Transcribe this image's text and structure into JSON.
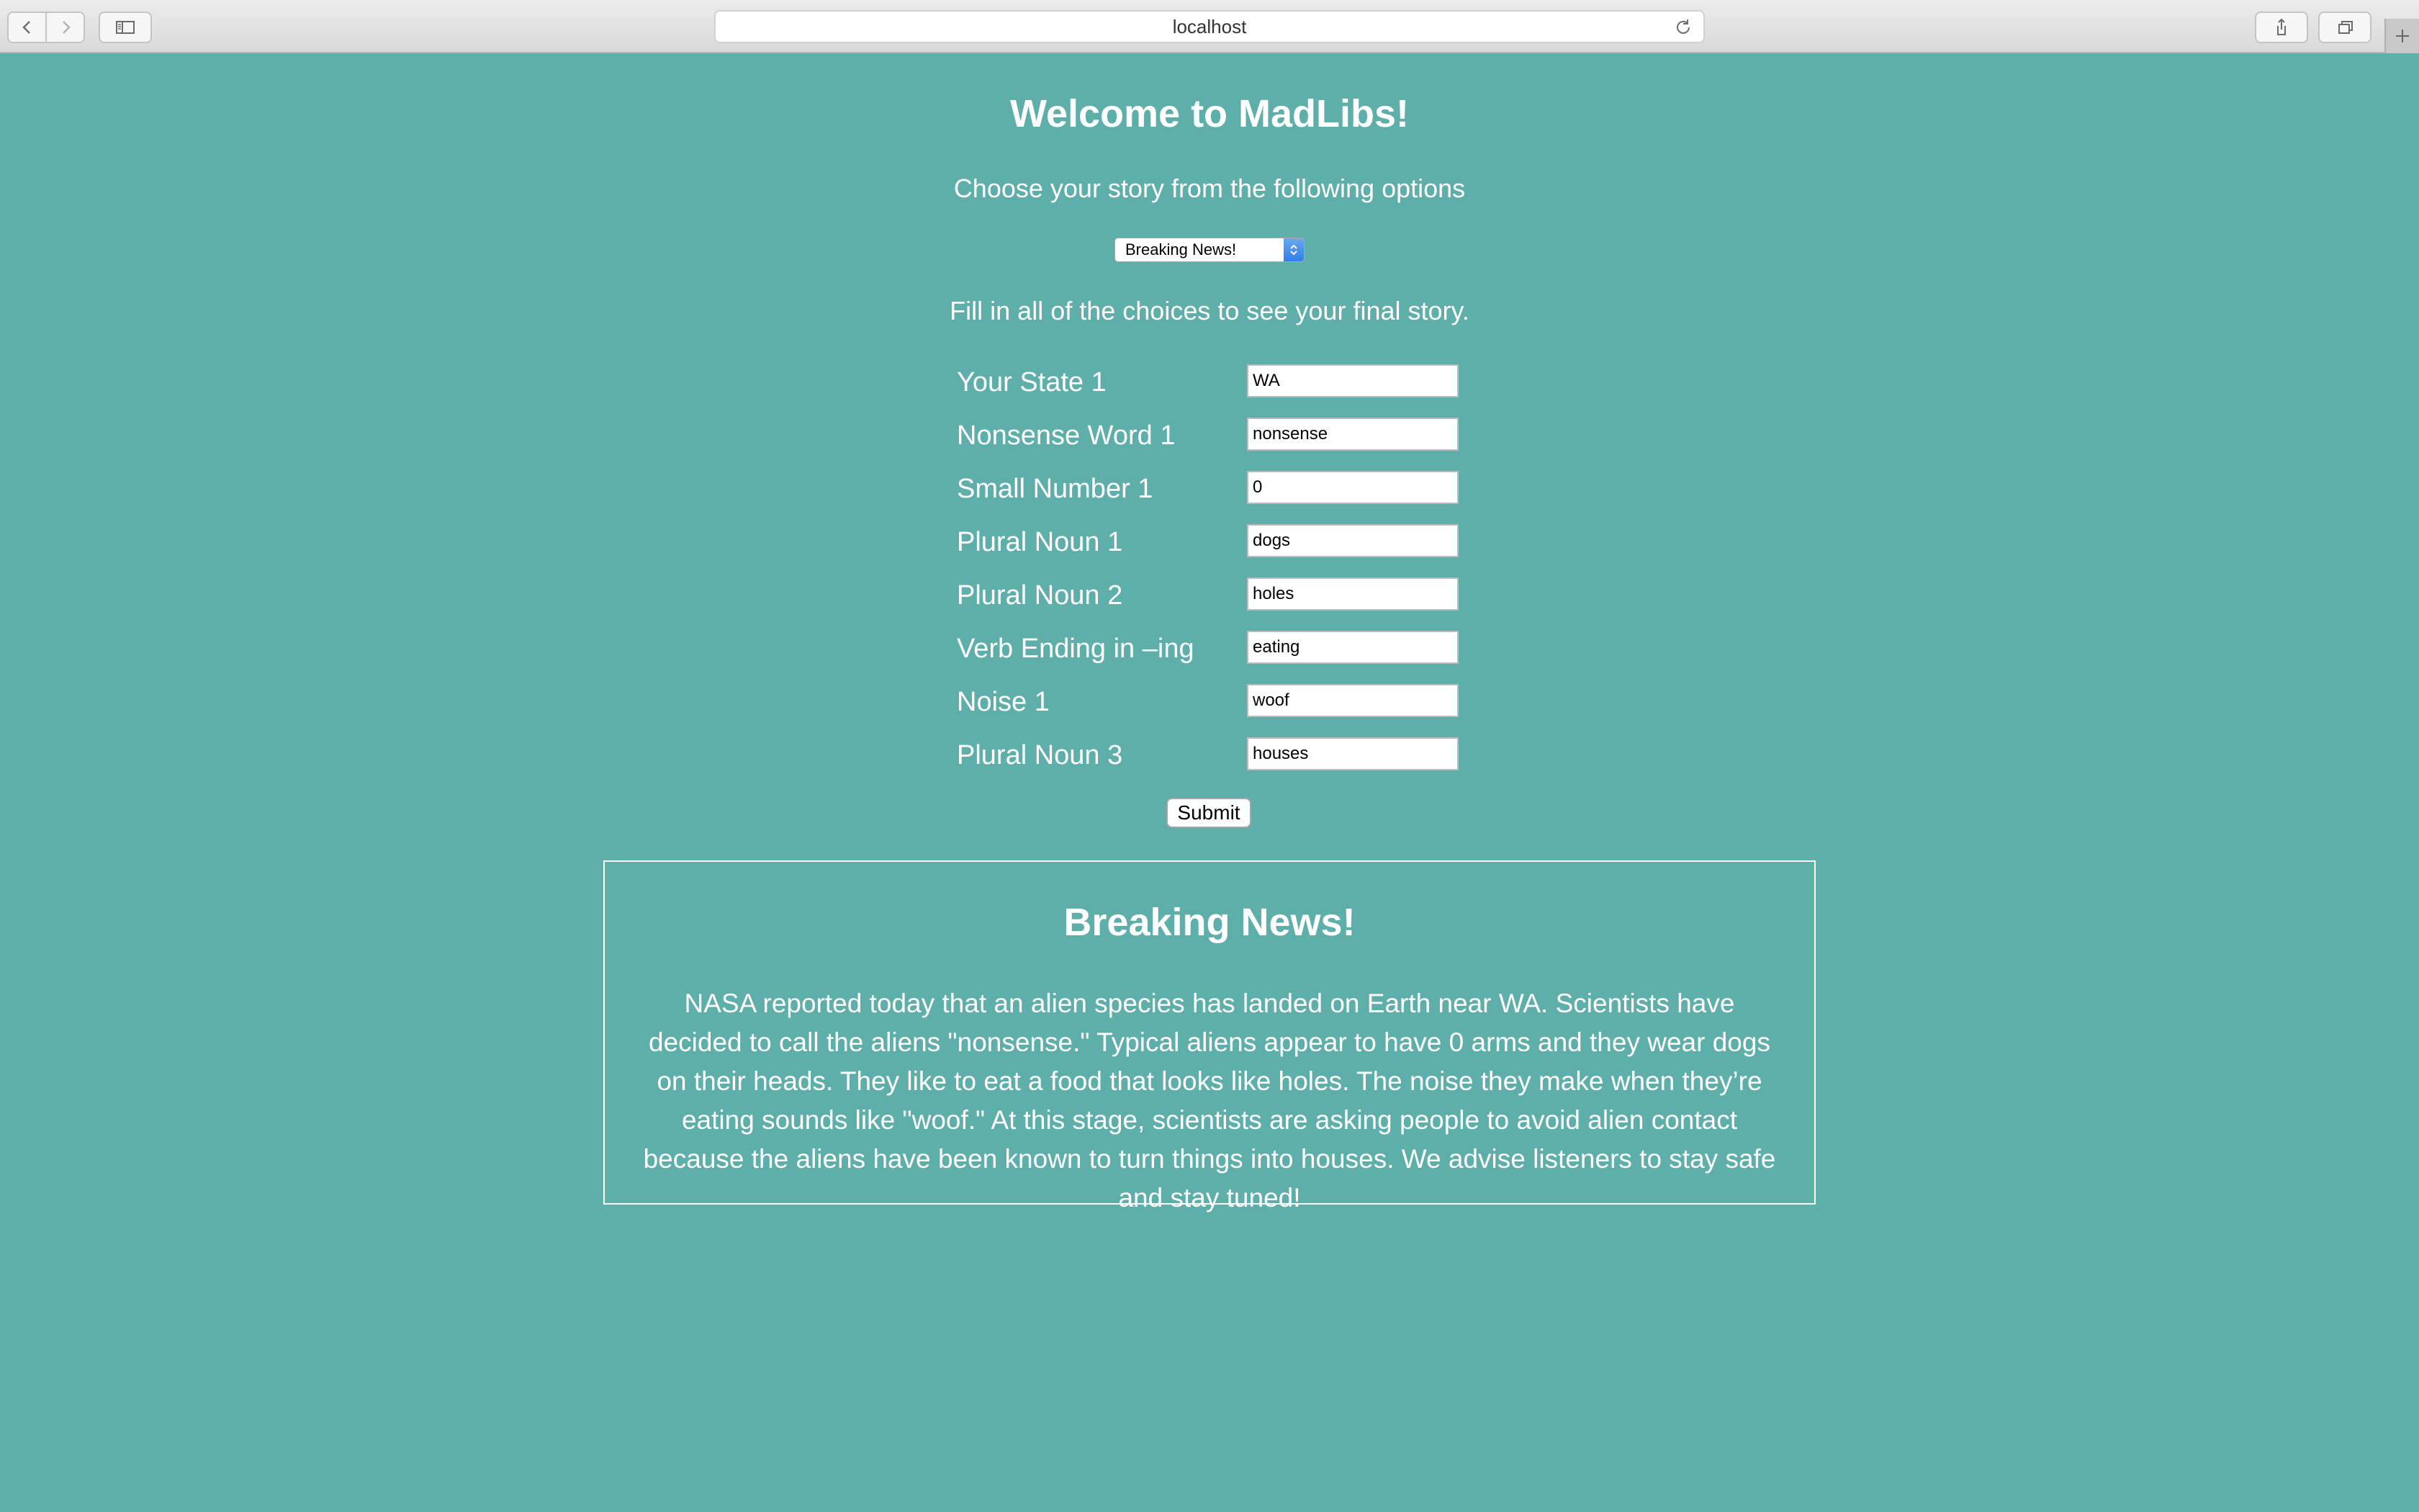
{
  "browser": {
    "url": "localhost"
  },
  "page": {
    "title": "Welcome to MadLibs!",
    "subtitle": "Choose your story from the following options",
    "story_select": {
      "selected": "Breaking News!"
    },
    "instructions": "Fill in all of the choices to see your final story.",
    "fields": [
      {
        "label": "Your State 1",
        "value": "WA"
      },
      {
        "label": "Nonsense Word 1",
        "value": "nonsense"
      },
      {
        "label": "Small Number 1",
        "value": "0"
      },
      {
        "label": "Plural Noun 1",
        "value": "dogs"
      },
      {
        "label": "Plural Noun 2",
        "value": "holes"
      },
      {
        "label": "Verb Ending in –ing",
        "value": "eating"
      },
      {
        "label": "Noise 1",
        "value": "woof"
      },
      {
        "label": "Plural Noun 3",
        "value": "houses"
      }
    ],
    "submit_label": "Submit",
    "story": {
      "title": "Breaking News!",
      "text": "NASA reported today that an alien species has landed on Earth near WA. Scientists have decided to call the aliens \"nonsense.\" Typical aliens appear to have 0 arms and they wear dogs on their heads. They like to eat a food that looks like holes. The noise they make when they’re eating sounds like \"woof.\" At this stage, scientists are asking people to avoid alien contact because the aliens have been known to turn things into houses. We advise listeners to stay safe and stay tuned!"
    }
  },
  "icons": {
    "back": "chevron-left-icon",
    "forward": "chevron-right-icon",
    "sidebar": "sidebar-icon",
    "reload": "reload-icon",
    "share": "share-icon",
    "tabs": "tabs-overview-icon",
    "new_tab": "plus-icon"
  }
}
